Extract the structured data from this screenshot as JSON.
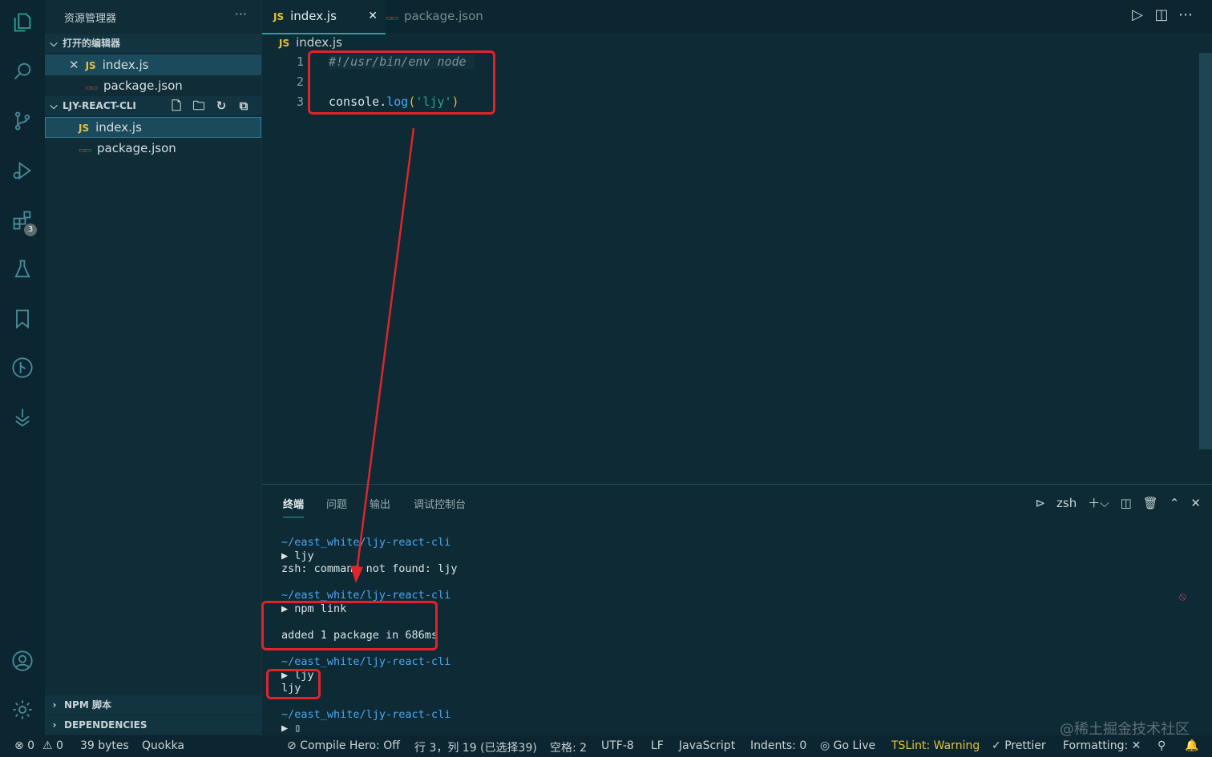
{
  "activity_bar": {
    "icons": [
      "explorer-icon",
      "search-icon",
      "source-control-icon",
      "run-debug-icon",
      "extensions-icon",
      "testing-icon",
      "bookmarks-icon",
      "git-graph-icon",
      "deploy-icon",
      "account-icon",
      "settings-icon"
    ],
    "extensions_badge": "3"
  },
  "sidebar": {
    "title": "资源管理器",
    "more": "···",
    "open_editors": {
      "label": "打开的编辑器",
      "items": [
        {
          "tag": "JS",
          "name": "index.js"
        },
        {
          "tag": "{}",
          "name": "package.json"
        }
      ]
    },
    "project": {
      "label": "LJY-REACT-CLI",
      "items": [
        {
          "tag": "JS",
          "name": "index.js"
        },
        {
          "tag": "{}",
          "name": "package.json"
        }
      ]
    },
    "npm_scripts": "NPM 脚本",
    "dependencies": "DEPENDENCIES"
  },
  "editor": {
    "tabs": [
      {
        "tag": "JS",
        "name": "index.js",
        "close": "✕"
      },
      {
        "tag": "{}",
        "name": "package.json"
      }
    ],
    "breadcrumb": {
      "tag": "JS",
      "name": "index.js"
    },
    "line_numbers": [
      "1",
      "2",
      "3"
    ],
    "line1": "#!/usr/bin/env node",
    "line3": {
      "ident": "console",
      "dot": ".",
      "fn": "log",
      "open": "(",
      "str": "'ljy'",
      "close": ")"
    }
  },
  "panel": {
    "tabs": [
      "终端",
      "问题",
      "输出",
      "调试控制台"
    ],
    "shell": "zsh",
    "terminal": [
      {
        "text": "~/east_white/ljy-react-cli",
        "kind": "path"
      },
      {
        "text": "▶ ljy",
        "kind": "text"
      },
      {
        "text": "zsh: command not found: ljy",
        "kind": "text"
      },
      {
        "text": "~/east_white/ljy-react-cli",
        "kind": "path"
      },
      {
        "text": "▶ npm link",
        "kind": "text"
      },
      {
        "text": "added 1 package in 686ms",
        "kind": "text"
      },
      {
        "text": "~/east_white/ljy-react-cli",
        "kind": "path"
      },
      {
        "text": "▶ ljy",
        "kind": "text"
      },
      {
        "text": "ljy",
        "kind": "text"
      },
      {
        "text": "~/east_white/ljy-react-cli",
        "kind": "path"
      },
      {
        "text": "▶ ▯",
        "kind": "text"
      }
    ]
  },
  "status_bar": {
    "errors": "⊗ 0",
    "warnings": "⚠ 0",
    "size": "39 bytes",
    "quokka": "Quokka",
    "compile_hero": "Compile Hero: Off",
    "cursor": "行 3，列 19 (已选择39)",
    "spaces": "空格: 2",
    "encoding": "UTF-8",
    "eol": "LF",
    "language": "JavaScript",
    "indents": "Indents: 0",
    "go_live": "Go Live",
    "tslint": "TSLint: Warning",
    "prettier": "Prettier",
    "formatting": "Formatting: ✕"
  },
  "watermark": "@稀土掘金技术社区",
  "colors": {
    "background": "#0d2a35",
    "accent": "#2aa198",
    "annotation": "#e0242b",
    "js_tag": "#e5c13d"
  }
}
